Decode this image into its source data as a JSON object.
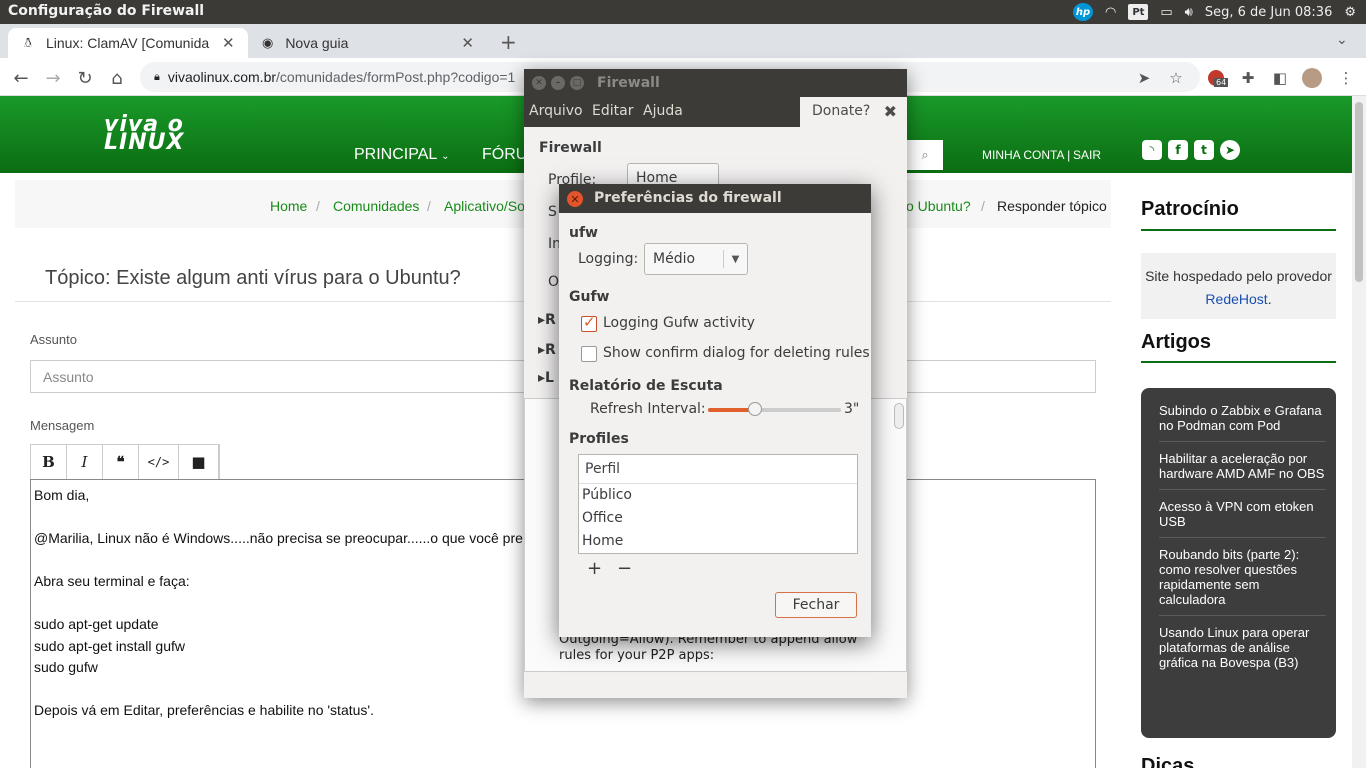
{
  "os": {
    "window_title": "Configuração do Firewall",
    "indicator_pt": "Pt",
    "clock": "Seg, 6 de Jun 08:36"
  },
  "browser": {
    "tabs": [
      {
        "label": "Linux: ClamAV [Comunida"
      },
      {
        "label": "Nova guia"
      }
    ],
    "url_host": "vivaolinux.com.br",
    "url_path": "/comunidades/formPost.php?codigo=1",
    "ext_badge": "64"
  },
  "site": {
    "logo_line1": "viva o",
    "logo_line2": "LINUX",
    "nav": [
      "PRINCIPAL",
      "FÓRU"
    ],
    "account": "MINHA CONTA",
    "logout": "SAIR",
    "breadcrumb": [
      "Home",
      "Comunidades",
      "Aplicativo/So",
      "o Ubuntu?"
    ],
    "breadcrumb_current": "Responder tópico",
    "topic_title": "Tópico: Existe algum anti vírus para o Ubuntu?",
    "subject_label": "Assunto",
    "subject_placeholder": "Assunto",
    "message_label": "Mensagem",
    "editor_text": "Bom dia,\n\n@Marilia, Linux não é Windows.....não precisa se preocupar......o que você pre\n\nAbra seu terminal e faça:\n\nsudo apt-get update\nsudo apt-get install gufw\nsudo gufw\n\nDepois vá em Editar, preferências e habilite no 'status'.",
    "sidebar": {
      "sponsor_title": "Patrocínio",
      "sponsor_text": "Site hospedado pelo provedor",
      "sponsor_link": "RedeHost",
      "articles_title": "Artigos",
      "articles": [
        "Subindo o Zabbix e Grafana no Podman com Pod",
        "Habilitar a aceleração por hardware AMD AMF no OBS",
        "Acesso à VPN com etoken USB",
        "Roubando bits (parte 2): como resolver questões rapidamente sem calculadora",
        "Usando Linux para operar plataformas de análise gráfica na Bovespa (B3)"
      ],
      "next_title": "Dicas"
    }
  },
  "firewall": {
    "title": "Firewall",
    "menu": [
      "Arquivo",
      "Editar",
      "Ajuda"
    ],
    "donate": "Donate?",
    "section": "Firewall",
    "profile_label": "Profile:",
    "profile_value": "Home",
    "partial_labels": [
      "S",
      "In",
      "O"
    ],
    "expanders": [
      "R",
      "R",
      "L"
    ],
    "info_text_1": "Outgoing=Allow). Remember to append allow",
    "info_text_2": "rules for your P2P apps:"
  },
  "prefs": {
    "title": "Preferências do firewall",
    "ufw_section": "ufw",
    "logging_label": "Logging:",
    "logging_value": "Médio",
    "gufw_section": "Gufw",
    "check1_label": "Logging Gufw activity",
    "check1_checked": true,
    "check2_label": "Show confirm dialog for deleting rules",
    "check2_checked": false,
    "listen_section": "Relatório de Escuta",
    "refresh_label": "Refresh Interval:",
    "refresh_value": "3\"",
    "refresh_fraction": 0.35,
    "profiles_section": "Profiles",
    "profiles_header": "Perfil",
    "profiles": [
      "Público",
      "Office",
      "Home"
    ],
    "add_symbol": "+",
    "remove_symbol": "−",
    "close_button": "Fechar"
  },
  "colors": {
    "site_green": "#0b6d12",
    "ubuntu_orange": "#e05a2b",
    "titlebar": "#3c3b37"
  }
}
